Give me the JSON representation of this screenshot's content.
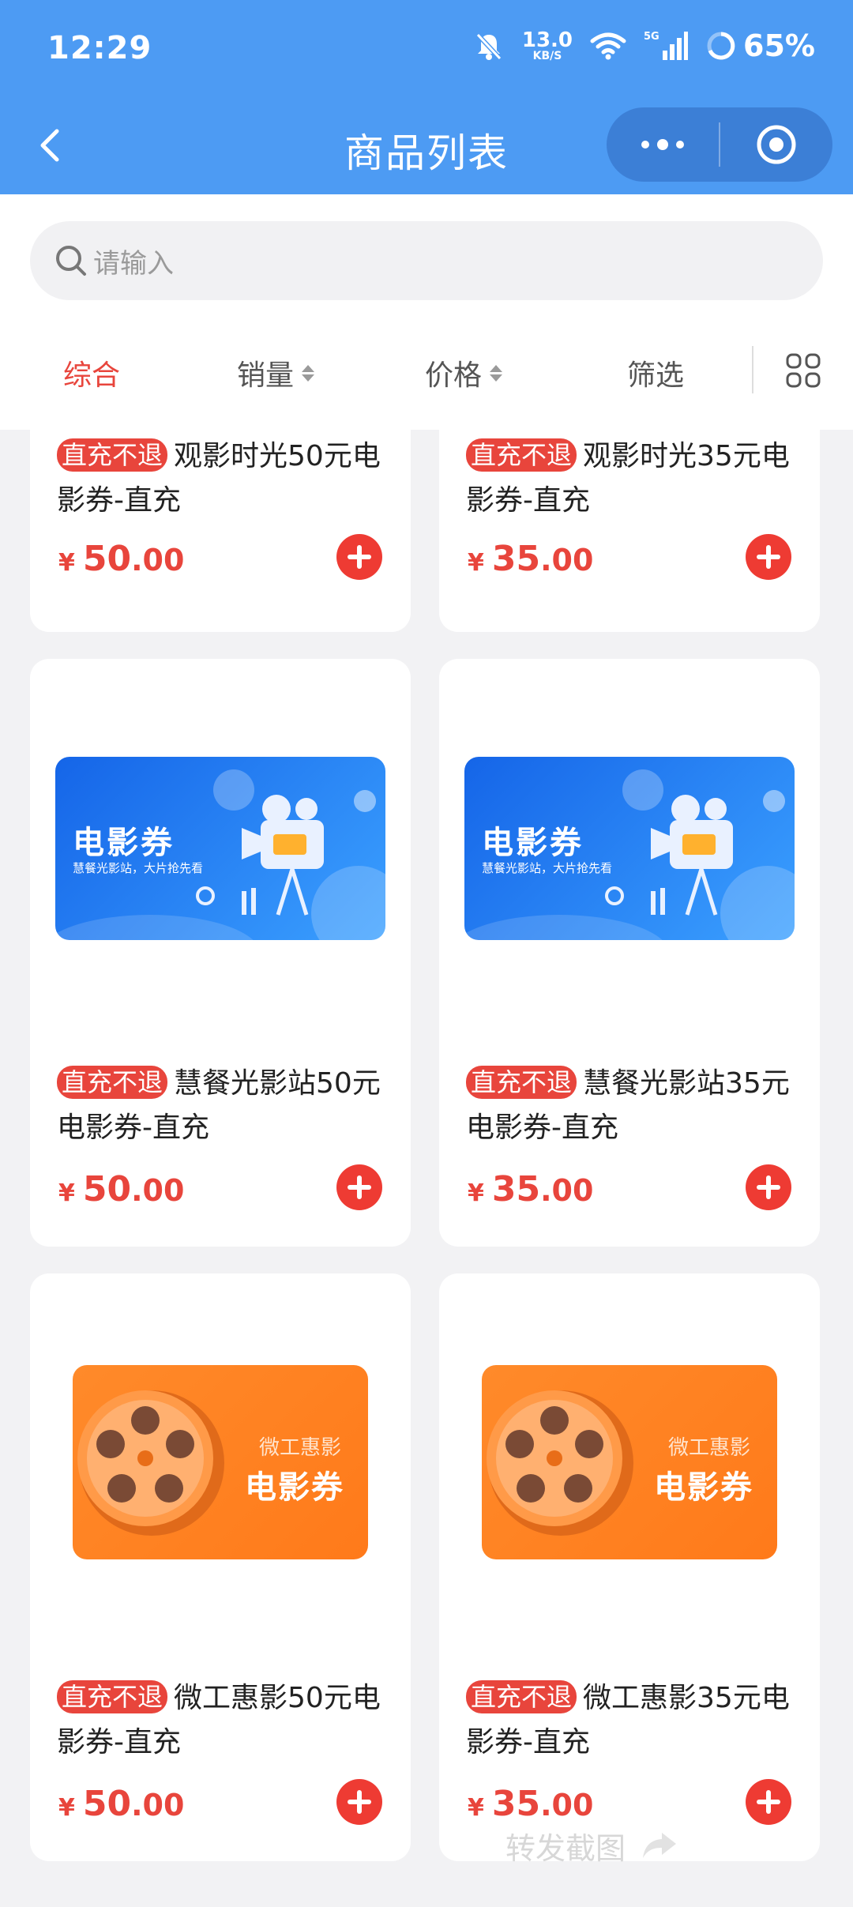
{
  "status_bar": {
    "time": "12:29",
    "net_speed": "13.0",
    "net_unit": "KB/S",
    "signal": "5G",
    "battery": "65%"
  },
  "navbar": {
    "title": "商品列表"
  },
  "search": {
    "placeholder": "请输入"
  },
  "filters": {
    "comprehensive": "综合",
    "sales": "销量",
    "price": "价格",
    "filter": "筛选"
  },
  "colors": {
    "brand_blue": "#4d9bf3",
    "accent_red": "#e8453c"
  },
  "products": [
    {
      "tag": "直充不退",
      "name": "观影时光50元电影券-直充",
      "currency": "¥",
      "price_int": "50",
      "price_dec": ".00"
    },
    {
      "tag": "直充不退",
      "name": "观影时光35元电影券-直充",
      "currency": "¥",
      "price_int": "35",
      "price_dec": ".00"
    },
    {
      "tag": "直充不退",
      "name": "慧餐光影站50元电影券-直充",
      "currency": "¥",
      "price_int": "50",
      "price_dec": ".00",
      "banner_title": "电影券",
      "banner_sub": "慧餐光影站，大片抢先看"
    },
    {
      "tag": "直充不退",
      "name": "慧餐光影站35元电影券-直充",
      "currency": "¥",
      "price_int": "35",
      "price_dec": ".00",
      "banner_title": "电影券",
      "banner_sub": "慧餐光影站，大片抢先看"
    },
    {
      "tag": "直充不退",
      "name": "微工惠影50元电影券-直充",
      "currency": "¥",
      "price_int": "50",
      "price_dec": ".00",
      "banner_sub": "微工惠影",
      "banner_title": "电影券"
    },
    {
      "tag": "直充不退",
      "name": "微工惠影35元电影券-直充",
      "currency": "¥",
      "price_int": "35",
      "price_dec": ".00",
      "banner_sub": "微工惠影",
      "banner_title": "电影券"
    }
  ],
  "share_overlay": {
    "label": "转发截图"
  }
}
